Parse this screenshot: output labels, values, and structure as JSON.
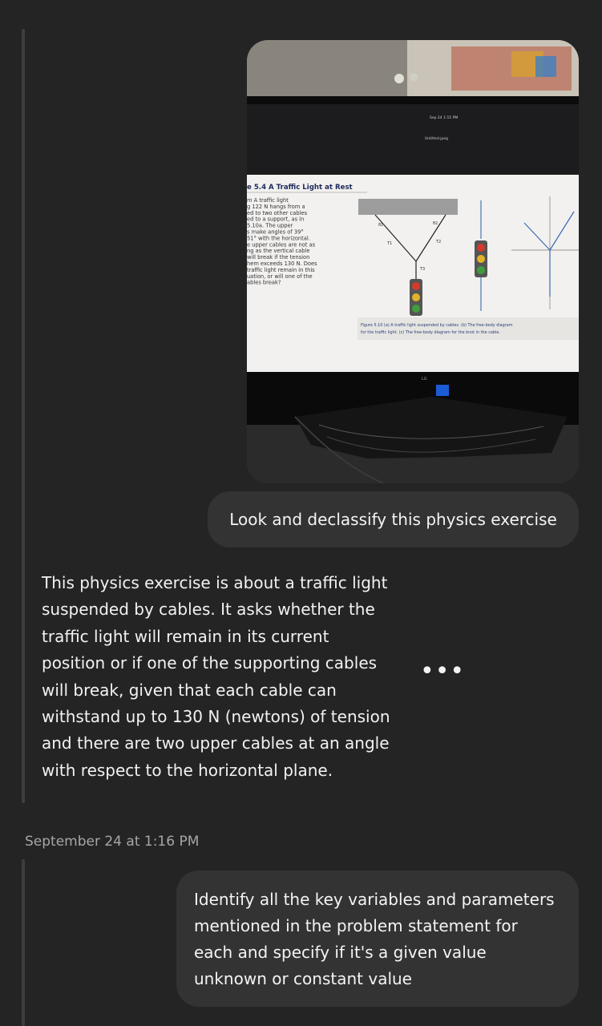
{
  "photo": {
    "alt": "",
    "screen_header": "Sep 24  1:15 PM",
    "screen_filename": "Untitled.jpeg",
    "example_title": "e 5.4 A Traffic Light at Rest",
    "problem_lines": [
      "m A traffic light",
      "g 122 N hangs from a",
      "ed to two other cables",
      "ed to a support, as in",
      "5.10a. The upper",
      "s make angles of 39°",
      "51° with the horizontal.",
      "e upper cables are not as",
      "ng as the vertical cable",
      "will break if the tension",
      "hem exceeds 130 N. Does",
      "traffic light remain in this",
      "uation, or will one of the",
      "ables break?"
    ],
    "figure_caption_1": "Figure 5.10 (a) A traffic light suspended by cables. (b) The free-body diagram",
    "figure_caption_2": "for the traffic light. (c) The free-body diagram for the knot in the cable.",
    "label_theta1": "θ1",
    "label_theta2": "θ2",
    "label_T1": "T1",
    "label_T2": "T2",
    "label_T3": "T3",
    "monitor_brand": "LG"
  },
  "messages": {
    "user_1": "Look and declassify this physics exercise",
    "assistant_1": "This physics exercise is about a traffic light\nsuspended by cables. It asks whether the\ntraffic light will remain in its current\nposition or if one of the supporting cables\nwill break, given that each cable can\nwithstand up to 130 N (newtons) of tension\nand there are two upper cables at an angle\nwith respect to the horizontal plane.",
    "more_label": "•••",
    "timestamp": "September 24 at 1:16 PM",
    "user_2": "Identify all the key variables and parameters\nmentioned in the problem statement for\neach and specify if it's a given value\nunknown or constant value"
  },
  "colors": {
    "background": "#242424",
    "bubble": "#333333",
    "text": "#f2f2f2",
    "timestamp": "#a6a6a6"
  }
}
